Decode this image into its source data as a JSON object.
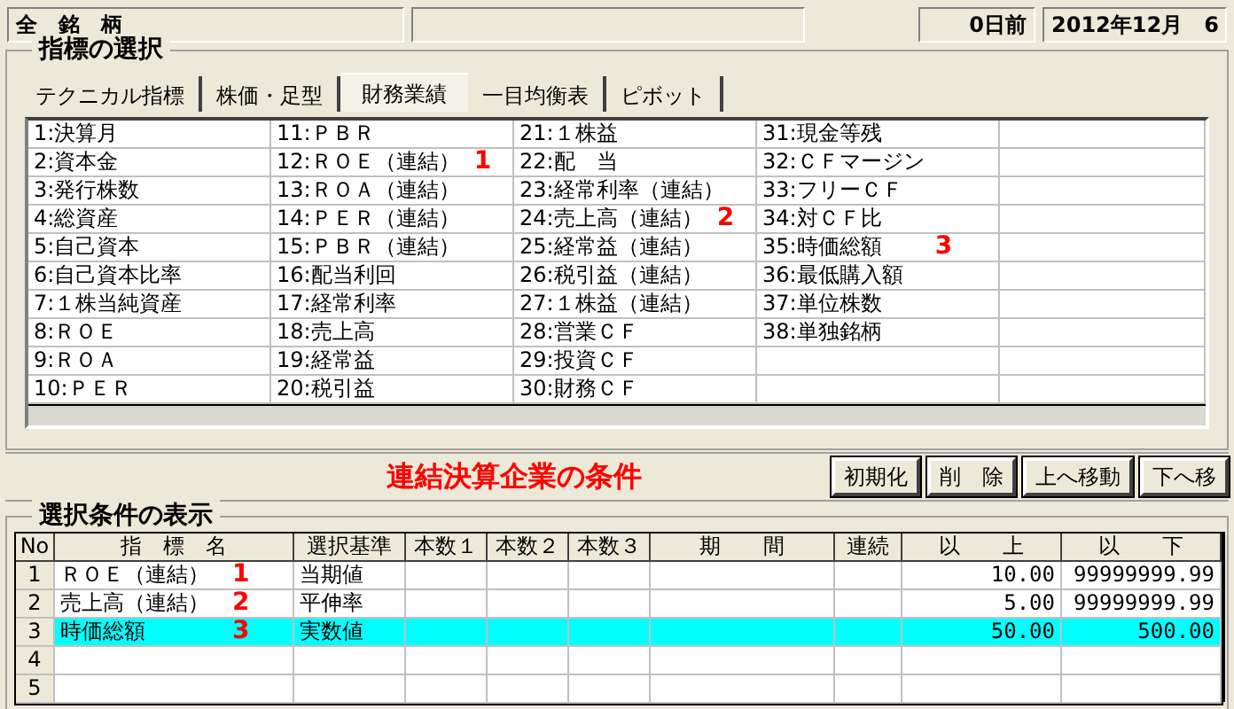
{
  "header": {
    "stock_field": "全　銘　柄",
    "days_ago": "0日前",
    "date": "2012年12月　6"
  },
  "indicator_group": {
    "title": "指標の選択",
    "tabs": [
      {
        "label": "テクニカル指標",
        "selected": false
      },
      {
        "label": "株価・足型",
        "selected": false
      },
      {
        "label": "財務業績",
        "selected": true
      },
      {
        "label": "一目均衡表",
        "selected": false
      },
      {
        "label": "ピボット",
        "selected": false
      }
    ],
    "columns": [
      [
        {
          "label": "1:決算月"
        },
        {
          "label": "2:資本金"
        },
        {
          "label": "3:発行株数"
        },
        {
          "label": "4:総資産"
        },
        {
          "label": "5:自己資本"
        },
        {
          "label": "6:自己資本比率"
        },
        {
          "label": "7:１株当純資産"
        },
        {
          "label": "8:ＲＯＥ"
        },
        {
          "label": "9:ＲＯＡ"
        },
        {
          "label": "10:ＰＥＲ"
        }
      ],
      [
        {
          "label": "11:ＰＢＲ"
        },
        {
          "label": "12:ＲＯＥ（連結）",
          "mark": "1"
        },
        {
          "label": "13:ＲＯＡ（連結）"
        },
        {
          "label": "14:ＰＥＲ（連結）"
        },
        {
          "label": "15:ＰＢＲ（連結）"
        },
        {
          "label": "16:配当利回"
        },
        {
          "label": "17:経常利率"
        },
        {
          "label": "18:売上高"
        },
        {
          "label": "19:経常益"
        },
        {
          "label": "20:税引益"
        }
      ],
      [
        {
          "label": "21:１株益"
        },
        {
          "label": "22:配　当"
        },
        {
          "label": "23:経常利率（連結）"
        },
        {
          "label": "24:売上高（連結）",
          "mark": "2"
        },
        {
          "label": "25:経常益（連結）"
        },
        {
          "label": "26:税引益（連結）"
        },
        {
          "label": "27:１株益（連結）"
        },
        {
          "label": "28:営業ＣＦ"
        },
        {
          "label": "29:投資ＣＦ"
        },
        {
          "label": "30:財務ＣＦ"
        }
      ],
      [
        {
          "label": "31:現金等残"
        },
        {
          "label": "32:ＣＦマージン"
        },
        {
          "label": "33:フリーＣＦ"
        },
        {
          "label": "34:対ＣＦ比"
        },
        {
          "label": "35:時価総額",
          "mark": "3"
        },
        {
          "label": "36:最低購入額"
        },
        {
          "label": "37:単位株数"
        },
        {
          "label": "38:単独銘柄"
        }
      ]
    ]
  },
  "condition_title": "連結決算企業の条件",
  "buttons": [
    "初期化",
    "削　除",
    "上へ移動",
    "下へ移"
  ],
  "conditions": {
    "title": "選択条件の表示",
    "columns": [
      "No",
      "指　標　名",
      "選択基準",
      "本数１",
      "本数２",
      "本数３",
      "期　　間",
      "連続",
      "以　　上",
      "以　　下"
    ],
    "rows": [
      {
        "no": "1",
        "name": "ＲＯＥ（連結）",
        "mark": "1",
        "criterion": "当期値",
        "min": "10.00",
        "max": "99999999.99",
        "selected": false
      },
      {
        "no": "2",
        "name": "売上高（連結）",
        "mark": "2",
        "criterion": "平伸率",
        "min": "5.00",
        "max": "99999999.99",
        "selected": false
      },
      {
        "no": "3",
        "name": "時価総額",
        "mark": "3",
        "criterion": "実数値",
        "min": "50.00",
        "max": "500.00",
        "selected": true
      },
      {
        "no": "4",
        "selected": false
      },
      {
        "no": "5",
        "selected": false
      }
    ]
  }
}
